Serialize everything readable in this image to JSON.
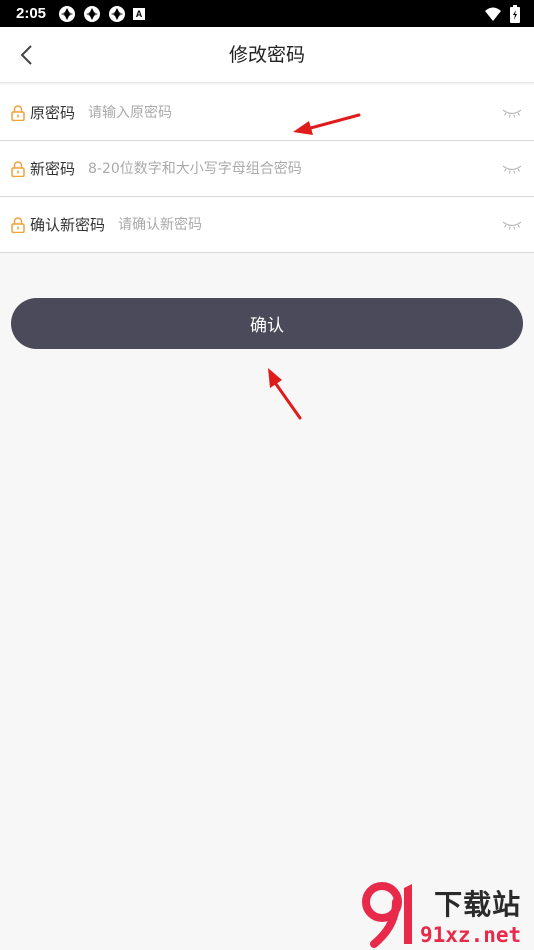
{
  "status_bar": {
    "time": "2:05",
    "badge": "A",
    "icons_left": [
      "shutter-icon",
      "shutter-icon",
      "shutter-icon",
      "a-badge-icon"
    ],
    "icons_right": [
      "wifi-icon",
      "battery-icon"
    ]
  },
  "header": {
    "title": "修改密码",
    "back_icon": "chevron-left-icon"
  },
  "form": {
    "fields": [
      {
        "label": "原密码",
        "placeholder": "请输入原密码",
        "value": ""
      },
      {
        "label": "新密码",
        "placeholder": "8-20位数字和大小写字母组合密码",
        "value": ""
      },
      {
        "label": "确认新密码",
        "placeholder": "请确认新密码",
        "value": ""
      }
    ]
  },
  "confirm_button": {
    "label": "确认"
  },
  "colors": {
    "accent_lock": "#f0a23a",
    "button_bg": "#4a4a5a",
    "annotation_arrow": "#e01b1b",
    "watermark_red": "#e8294a"
  },
  "watermark": {
    "cn": "下载站",
    "en": "91xz.net"
  }
}
